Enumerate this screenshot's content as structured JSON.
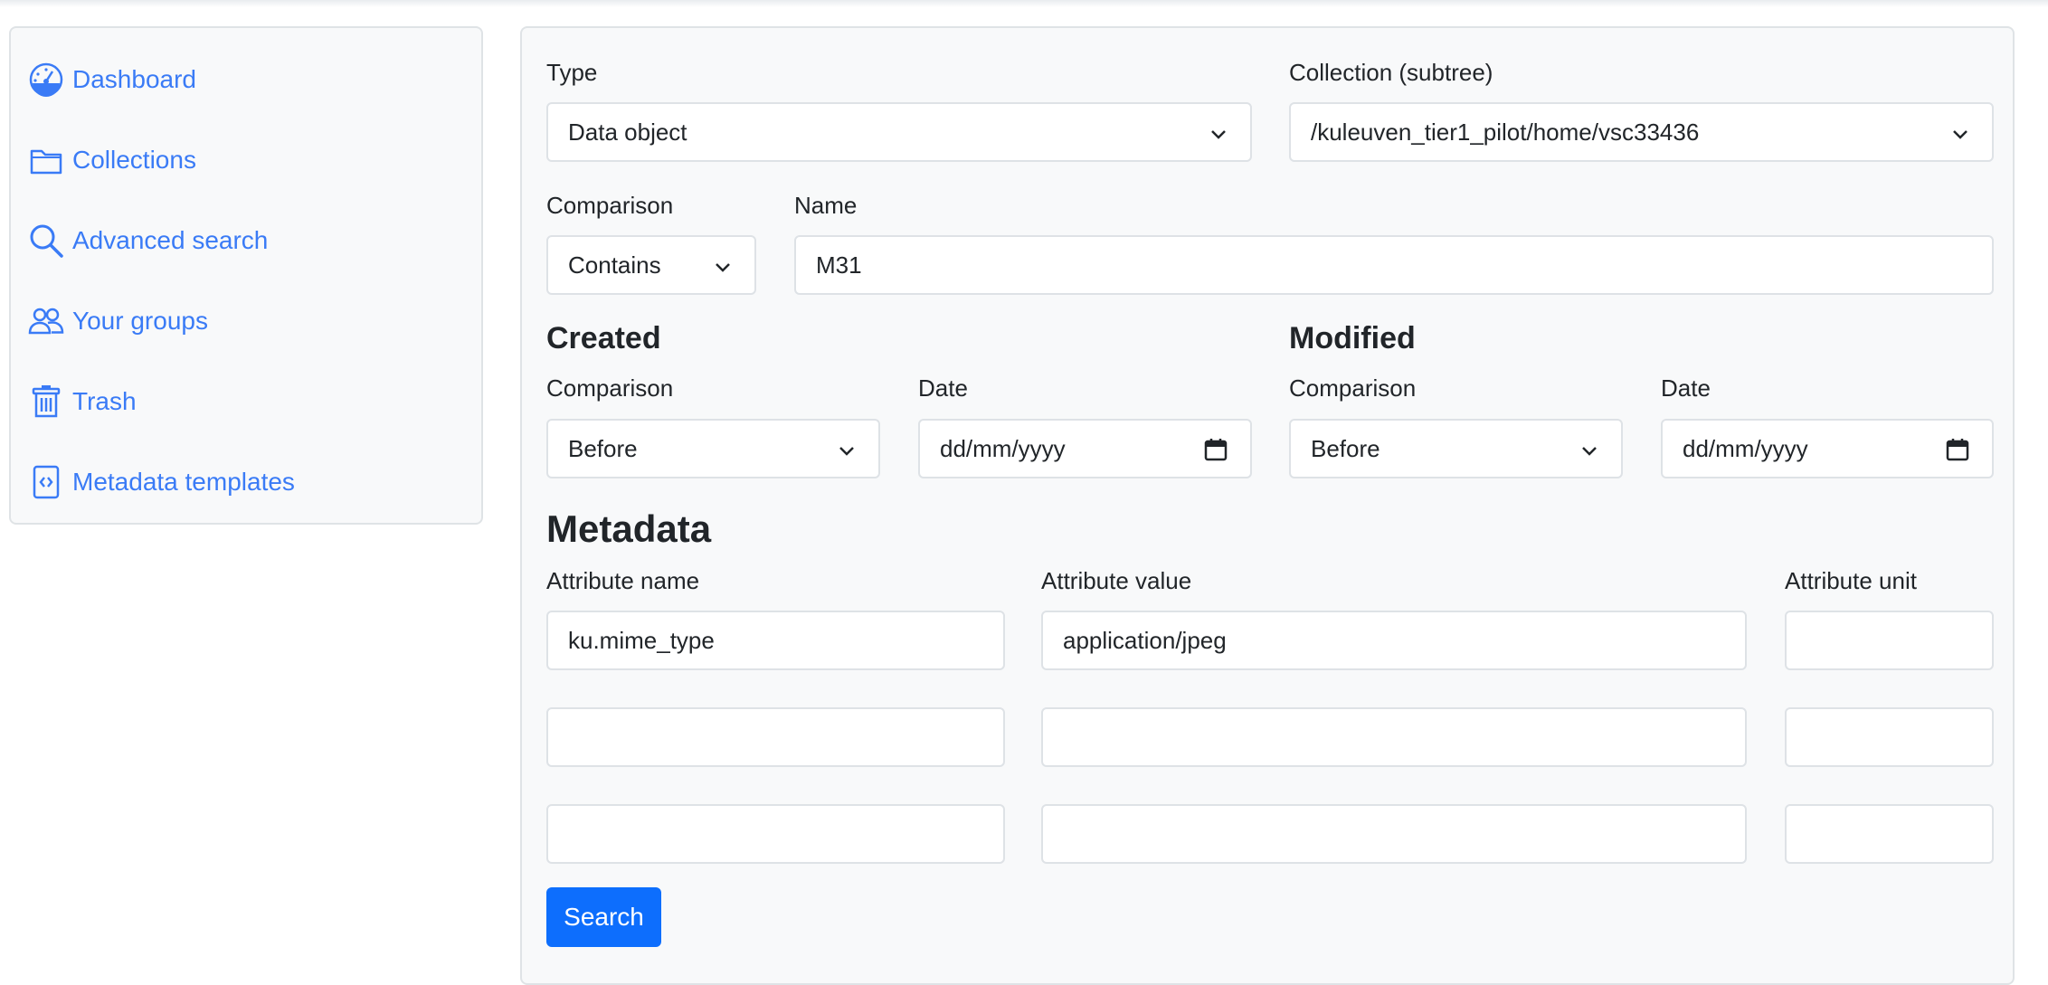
{
  "sidebar": {
    "items": [
      {
        "label": "Dashboard",
        "icon": "speedometer-icon"
      },
      {
        "label": "Collections",
        "icon": "folder-icon"
      },
      {
        "label": "Advanced search",
        "icon": "search-icon"
      },
      {
        "label": "Your groups",
        "icon": "people-icon"
      },
      {
        "label": "Trash",
        "icon": "trash-icon"
      },
      {
        "label": "Metadata templates",
        "icon": "code-file-icon"
      }
    ],
    "link_color": "#3a7bf6"
  },
  "form": {
    "type_label": "Type",
    "type_value": "Data object",
    "collection_label": "Collection (subtree)",
    "collection_value": "/kuleuven_tier1_pilot/home/vsc33436",
    "name_comparison_label": "Comparison",
    "name_comparison_value": "Contains",
    "name_label": "Name",
    "name_value": "M31",
    "created": {
      "heading": "Created",
      "comparison_label": "Comparison",
      "comparison_value": "Before",
      "date_label": "Date",
      "date_placeholder": "dd/mm/yyyy"
    },
    "modified": {
      "heading": "Modified",
      "comparison_label": "Comparison",
      "comparison_value": "Before",
      "date_label": "Date",
      "date_placeholder": "dd/mm/yyyy"
    },
    "metadata": {
      "heading": "Metadata",
      "attr_name_label": "Attribute name",
      "attr_value_label": "Attribute value",
      "attr_unit_label": "Attribute unit",
      "rows": [
        {
          "name": "ku.mime_type",
          "value": "application/jpeg",
          "unit": ""
        },
        {
          "name": "",
          "value": "",
          "unit": ""
        },
        {
          "name": "",
          "value": "",
          "unit": ""
        }
      ]
    },
    "search_button": "Search",
    "button_color": "#0d6efd"
  }
}
